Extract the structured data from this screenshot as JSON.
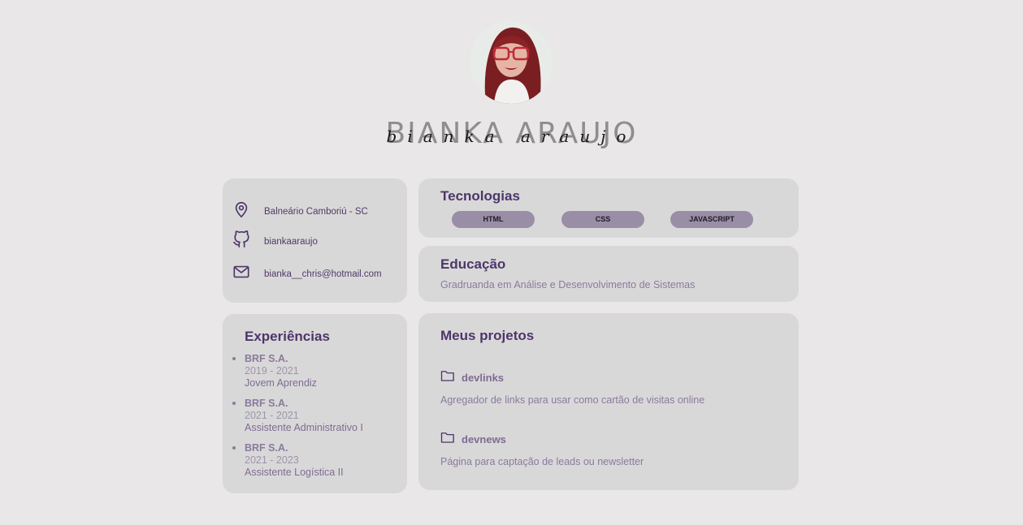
{
  "profile": {
    "name_main": "BIANKA ARAUJO",
    "name_script": "bianka araujo"
  },
  "contacts": [
    {
      "icon": "map-pin-icon",
      "text": "Balneário Camboriú - SC"
    },
    {
      "icon": "github-icon",
      "text": "biankaaraujo"
    },
    {
      "icon": "mail-icon",
      "text": "bianka__chris@hotmail.com"
    }
  ],
  "technologies": {
    "title": "Tecnologias",
    "items": [
      "HTML",
      "CSS",
      "JAVASCRIPT"
    ]
  },
  "education": {
    "title": "Educação",
    "text": "Gradruanda em Análise e Desenvolvimento de Sistemas"
  },
  "experiences": {
    "title": "Experiências",
    "items": [
      {
        "company": "BRF S.A.",
        "period": "2019 - 2021",
        "role": "Jovem Aprendiz"
      },
      {
        "company": "BRF S.A.",
        "period": "2021 - 2021",
        "role": "Assistente Administrativo I"
      },
      {
        "company": "BRF S.A.",
        "period": "2021 - 2023",
        "role": "Assistente Logística II"
      }
    ]
  },
  "projects": {
    "title": "Meus projetos",
    "items": [
      {
        "name": "devlinks",
        "description": "Agregador de links para usar como cartão de visitas online"
      },
      {
        "name": "devnews",
        "description": "Página para captação de leads ou newsletter"
      }
    ]
  },
  "colors": {
    "background": "#e9e7e8",
    "card": "#d9d8d9",
    "accent": "#4d3669",
    "pill": "#9a8ea6"
  }
}
